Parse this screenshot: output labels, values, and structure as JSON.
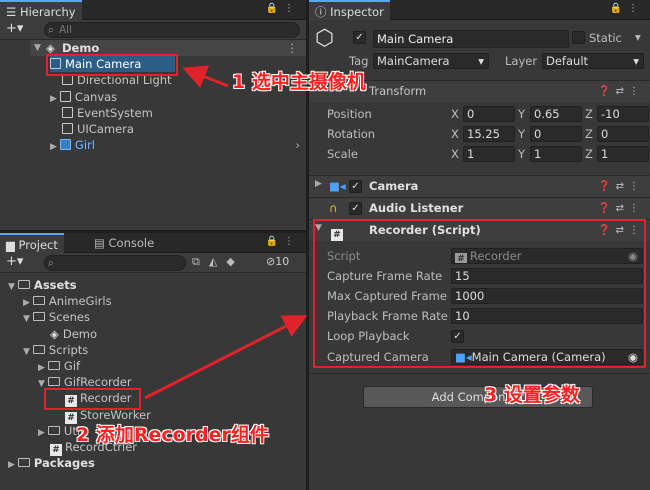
{
  "hierarchy": {
    "tab": "Hierarchy",
    "search_placeholder": "All",
    "scene": "Demo",
    "items": [
      "Main Camera",
      "Directional Light",
      "Canvas",
      "EventSystem",
      "UICamera",
      "Girl"
    ]
  },
  "project": {
    "tab_project": "Project",
    "tab_console": "Console",
    "hidden_count": "10",
    "tree": [
      {
        "label": "Assets",
        "level": 0
      },
      {
        "label": "AnimeGirls",
        "level": 1
      },
      {
        "label": "Scenes",
        "level": 1
      },
      {
        "label": "Demo",
        "level": 2
      },
      {
        "label": "Scripts",
        "level": 1
      },
      {
        "label": "Gif",
        "level": 2
      },
      {
        "label": "GifRecorder",
        "level": 2
      },
      {
        "label": "Recorder",
        "level": 3
      },
      {
        "label": "StoreWorker",
        "level": 3
      },
      {
        "label": "Util",
        "level": 2
      },
      {
        "label": "RecordCtrler",
        "level": 2
      },
      {
        "label": "Packages",
        "level": 0
      }
    ]
  },
  "inspector": {
    "tab": "Inspector",
    "object_name": "Main Camera",
    "static_label": "Static",
    "tag_label": "Tag",
    "tag_value": "MainCamera",
    "layer_label": "Layer",
    "layer_value": "Default",
    "transform": {
      "title": "Transform",
      "position": "Position",
      "rotation": "Rotation",
      "scale": "Scale",
      "pos": [
        "0",
        "0.65",
        "-10"
      ],
      "rot": [
        "15.25",
        "0",
        "0"
      ],
      "scl": [
        "1",
        "1",
        "1"
      ],
      "x": "X",
      "y": "Y",
      "z": "Z"
    },
    "camera": "Camera",
    "audio": "Audio Listener",
    "recorder": {
      "title": "Recorder (Script)",
      "script_label": "Script",
      "script_value": "Recorder",
      "capture_fr_label": "Capture Frame Rate",
      "capture_fr": "15",
      "max_frames_label": "Max Captured Frame",
      "max_frames": "1000",
      "playback_fr_label": "Playback Frame Rate",
      "playback_fr": "10",
      "loop_label": "Loop Playback",
      "captured_cam_label": "Captured Camera",
      "captured_cam": "Main Camera (Camera)"
    },
    "add_component": "Add Component"
  },
  "annotations": {
    "a1": "1 选中主摄像机",
    "a2": "2 添加Recorder组件",
    "a3": "3 设置参数"
  },
  "colors": {
    "annotation": "#e0232a",
    "tab_accent": "#58a6ff",
    "girl_blue": "#6fb7ff"
  }
}
